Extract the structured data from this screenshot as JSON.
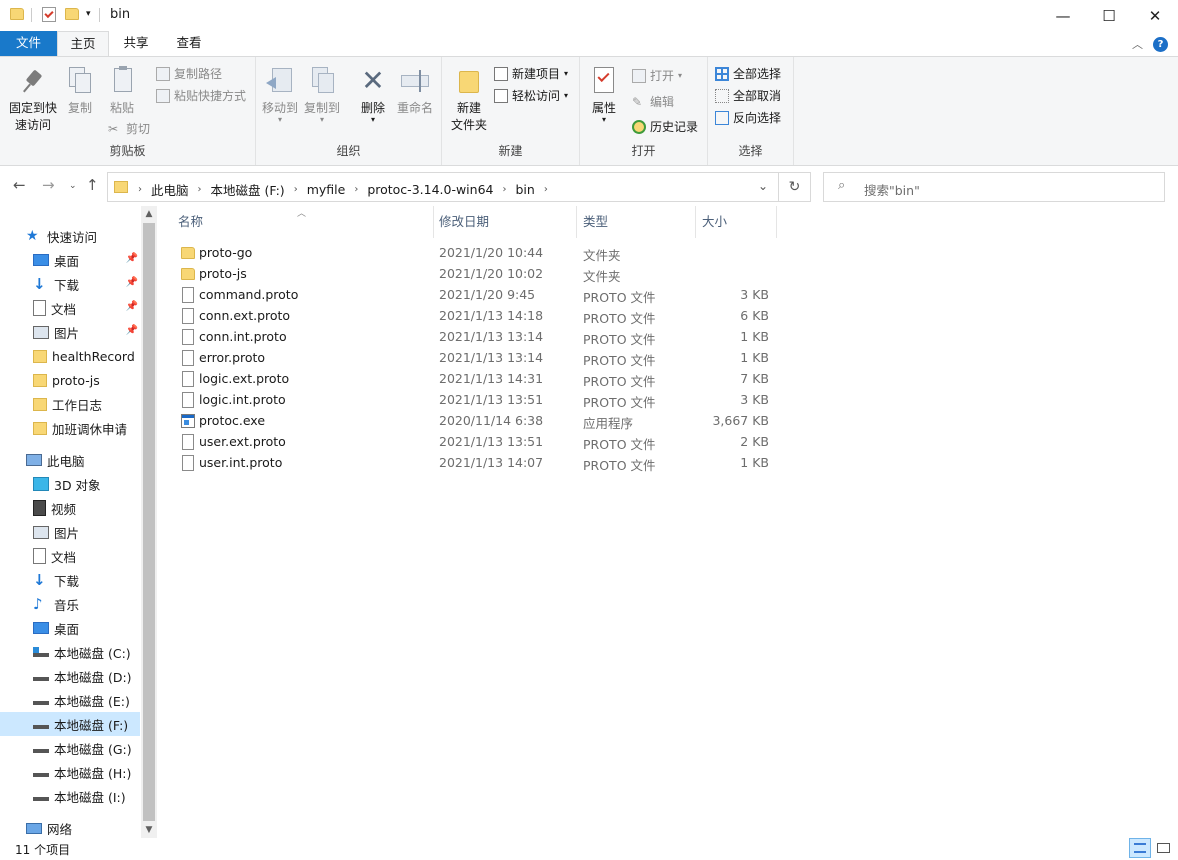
{
  "window": {
    "title": "bin",
    "minimize": "—",
    "maximize": "☐",
    "close": "✕"
  },
  "tabs": {
    "file": "文件",
    "home": "主页",
    "share": "共享",
    "view": "查看"
  },
  "ribbon": {
    "clipboard": {
      "label": "剪贴板",
      "pin_quick": "固定到快\n速访问",
      "pin_quick_1": "固定到快",
      "pin_quick_2": "速访问",
      "copy": "复制",
      "paste": "粘贴",
      "copy_path": "复制路径",
      "paste_shortcut": "粘贴快捷方式",
      "cut": "剪切"
    },
    "organize": {
      "label": "组织",
      "move_to": "移动到",
      "copy_to": "复制到",
      "delete": "删除",
      "rename": "重命名"
    },
    "new": {
      "label": "新建",
      "new_item": "新建项目",
      "easy_access": "轻松访问",
      "new_folder_1": "新建",
      "new_folder_2": "文件夹"
    },
    "open": {
      "label": "打开",
      "properties": "属性",
      "open": "打开",
      "edit": "编辑",
      "history": "历史记录"
    },
    "select": {
      "label": "选择",
      "select_all": "全部选择",
      "select_none": "全部取消",
      "invert": "反向选择"
    }
  },
  "address": {
    "crumbs": [
      "此电脑",
      "本地磁盘 (F:)",
      "myfile",
      "protoc-3.14.0-win64",
      "bin"
    ],
    "search_placeholder": "搜索\"bin\""
  },
  "sidebar": {
    "quick_access": "快速访问",
    "quick_items": [
      "桌面",
      "下载",
      "文档",
      "图片",
      "healthRecord",
      "proto-js",
      "工作日志",
      "加班调休申请"
    ],
    "this_pc": "此电脑",
    "pc_items": [
      "3D 对象",
      "视频",
      "图片",
      "文档",
      "下载",
      "音乐",
      "桌面",
      "本地磁盘 (C:)",
      "本地磁盘 (D:)",
      "本地磁盘 (E:)",
      "本地磁盘 (F:)",
      "本地磁盘 (G:)",
      "本地磁盘 (H:)",
      "本地磁盘 (I:)"
    ],
    "network": "网络"
  },
  "columns": {
    "name": "名称",
    "date": "修改日期",
    "type": "类型",
    "size": "大小"
  },
  "files": [
    {
      "name": "proto-go",
      "date": "2021/1/20 10:44",
      "type": "文件夹",
      "size": "",
      "icon": "folder"
    },
    {
      "name": "proto-js",
      "date": "2021/1/20 10:02",
      "type": "文件夹",
      "size": "",
      "icon": "folder"
    },
    {
      "name": "command.proto",
      "date": "2021/1/20 9:45",
      "type": "PROTO 文件",
      "size": "3 KB",
      "icon": "doc"
    },
    {
      "name": "conn.ext.proto",
      "date": "2021/1/13 14:18",
      "type": "PROTO 文件",
      "size": "6 KB",
      "icon": "doc"
    },
    {
      "name": "conn.int.proto",
      "date": "2021/1/13 13:14",
      "type": "PROTO 文件",
      "size": "1 KB",
      "icon": "doc"
    },
    {
      "name": "error.proto",
      "date": "2021/1/13 13:14",
      "type": "PROTO 文件",
      "size": "1 KB",
      "icon": "doc"
    },
    {
      "name": "logic.ext.proto",
      "date": "2021/1/13 14:31",
      "type": "PROTO 文件",
      "size": "7 KB",
      "icon": "doc"
    },
    {
      "name": "logic.int.proto",
      "date": "2021/1/13 13:51",
      "type": "PROTO 文件",
      "size": "3 KB",
      "icon": "doc"
    },
    {
      "name": "protoc.exe",
      "date": "2020/11/14 6:38",
      "type": "应用程序",
      "size": "3,667 KB",
      "icon": "exe"
    },
    {
      "name": "user.ext.proto",
      "date": "2021/1/13 13:51",
      "type": "PROTO 文件",
      "size": "2 KB",
      "icon": "doc"
    },
    {
      "name": "user.int.proto",
      "date": "2021/1/13 14:07",
      "type": "PROTO 文件",
      "size": "1 KB",
      "icon": "doc"
    }
  ],
  "status": {
    "count": "11 个项目"
  }
}
